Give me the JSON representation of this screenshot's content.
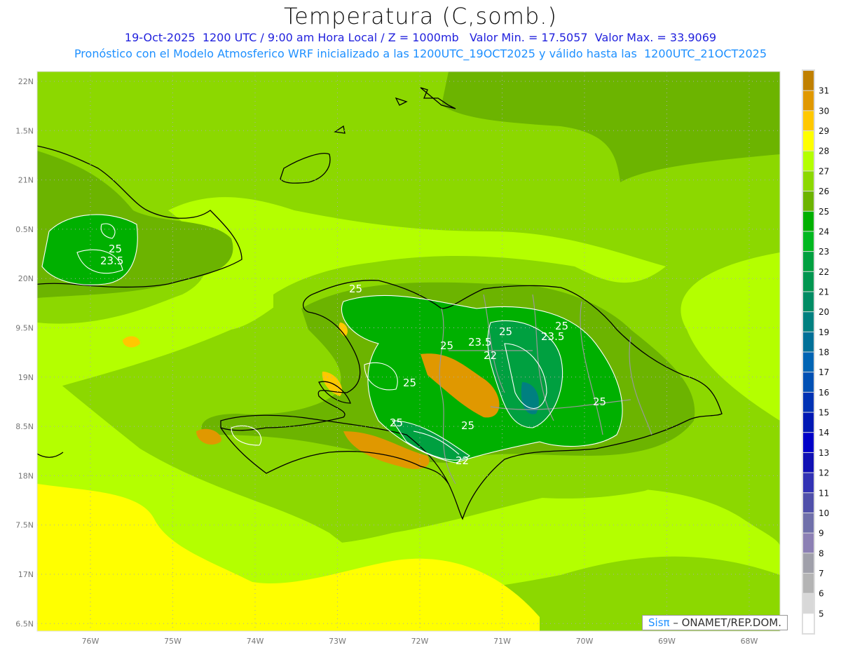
{
  "header": {
    "title": "Temperatura (C,somb.)",
    "subtitle1": "19-Oct-2025  1200 UTC / 9:00 am Hora Local / Z = 1000mb   Valor Min. = 17.5057  Valor Max. = 33.9069",
    "subtitle2": "Pronóstico con el Modelo Atmosferico WRF inicializado a las 1200UTC_19OCT2025 y válido hasta las  1200UTC_21OCT2025"
  },
  "axes": {
    "lon_labels": [
      "76W",
      "75W",
      "74W",
      "73W",
      "72W",
      "71W",
      "70W",
      "69W",
      "68W"
    ],
    "lat_labels": [
      "22N",
      "1.5N",
      "21N",
      "0.5N",
      "20N",
      "9.5N",
      "19N",
      "8.5N",
      "18N",
      "7.5N",
      "17N",
      "6.5N"
    ]
  },
  "colorbar": {
    "labels": [
      "31",
      "30",
      "29",
      "28",
      "27",
      "26",
      "25",
      "24",
      "23",
      "22",
      "21",
      "20",
      "19",
      "18",
      "17",
      "16",
      "15",
      "14",
      "13",
      "12",
      "11",
      "10",
      "9",
      "8",
      "7",
      "6",
      "5"
    ],
    "colors": [
      "#c08000",
      "#e09800",
      "#ffc800",
      "#ffff00",
      "#b4ff00",
      "#8cd800",
      "#6cb400",
      "#00b000",
      "#00b820",
      "#00a040",
      "#009650",
      "#008c64",
      "#008080",
      "#007098",
      "#0064b4",
      "#0050b4",
      "#0032b4",
      "#0018b4",
      "#0000c8",
      "#1010b4",
      "#3232b4",
      "#5050aa",
      "#7070aa",
      "#8c80b4",
      "#a0a0aa",
      "#b4b4b4",
      "#d8d8d8",
      "#ffffff"
    ]
  },
  "contour_labels": [
    "25",
    "23.5",
    "25",
    "25",
    "23.5",
    "25",
    "25",
    "23.5",
    "22",
    "25",
    "25",
    "22",
    "25",
    "25"
  ],
  "credit": {
    "brand": "Sisπ",
    "text": " – ONAMET/REP.DOM."
  }
}
